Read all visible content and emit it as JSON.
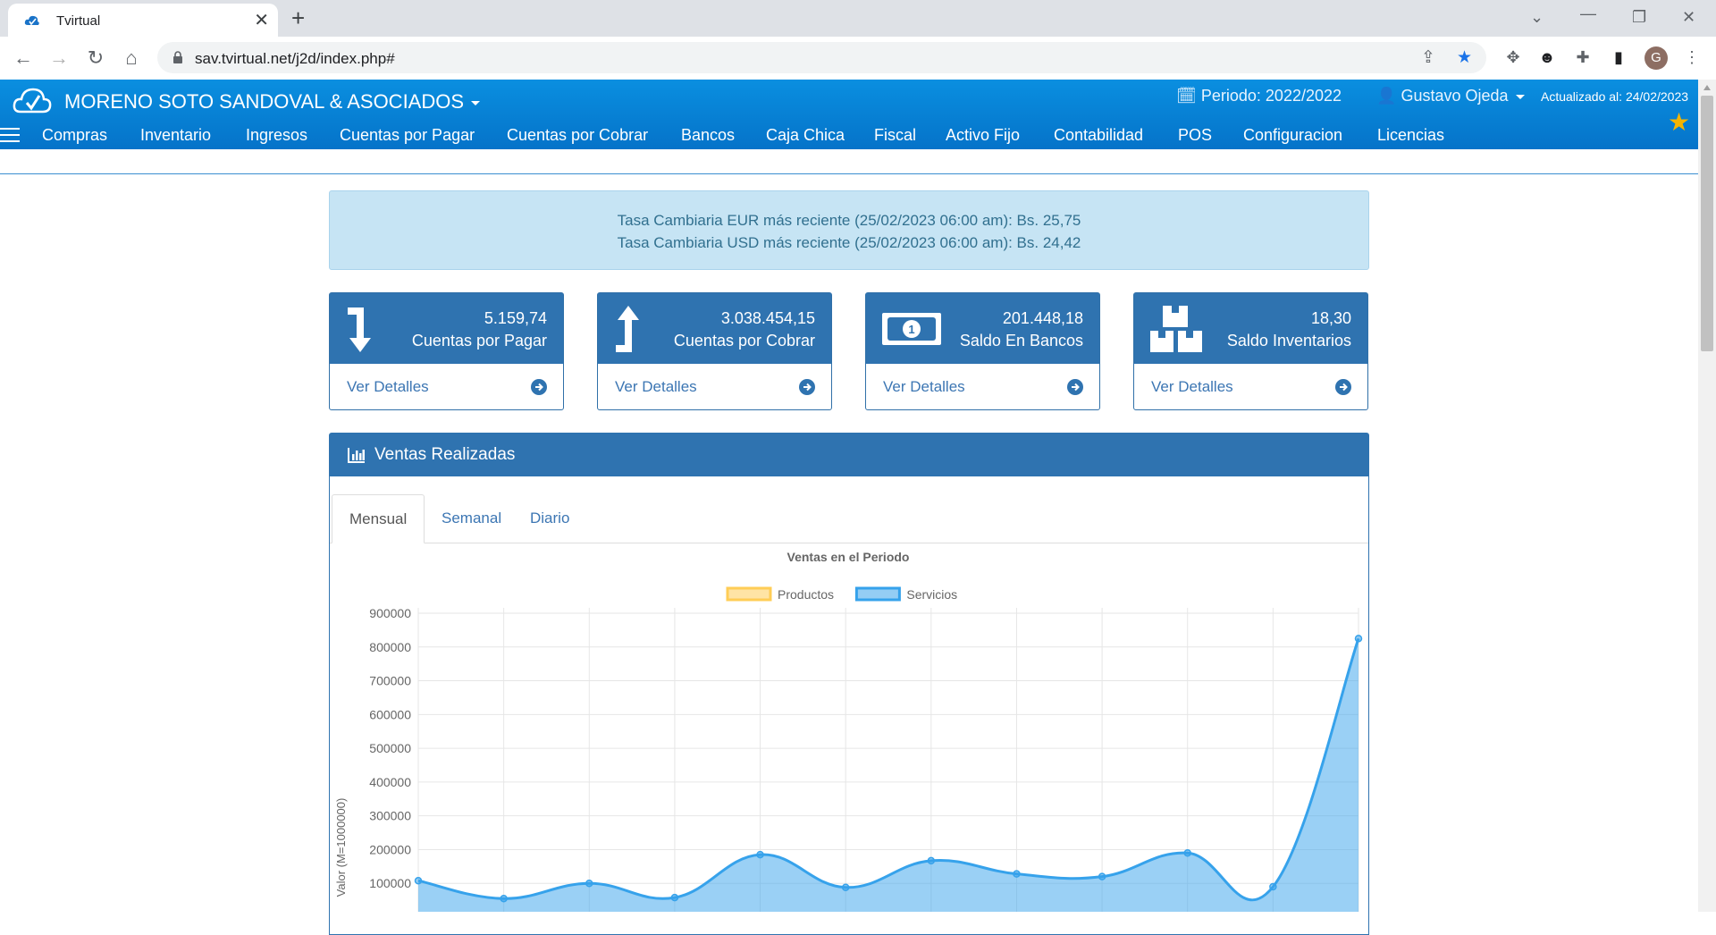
{
  "browser": {
    "tab_title": "Tvirtual",
    "tab_close": "✕",
    "new_tab": "+",
    "url": "sav.tvirtual.net/j2d/index.php#"
  },
  "header": {
    "company": "MORENO SOTO SANDOVAL & ASOCIADOS",
    "periodo": "Periodo: 2022/2022",
    "user": "Gustavo Ojeda",
    "actualizado": "Actualizado al: 24/02/2023"
  },
  "menu": [
    "Compras",
    "Inventario",
    "Ingresos",
    "Cuentas por Pagar",
    "Cuentas por Cobrar",
    "Bancos",
    "Caja Chica",
    "Fiscal",
    "Activo Fijo",
    "Contabilidad",
    "POS",
    "Configuracion",
    "Licencias"
  ],
  "alert": {
    "line1": "Tasa Cambiaria EUR más reciente (25/02/2023 06:00 am): Bs. 25,75",
    "line2": "Tasa Cambiaria USD más reciente (25/02/2023 06:00 am): Bs. 24,42"
  },
  "cards": [
    {
      "value": "5.159,74",
      "label": "Cuentas por Pagar",
      "link": "Ver Detalles",
      "icon": "arrow-down-icon"
    },
    {
      "value": "3.038.454,15",
      "label": "Cuentas por Cobrar",
      "link": "Ver Detalles",
      "icon": "arrow-up-icon"
    },
    {
      "value": "201.448,18",
      "label": "Saldo En Bancos",
      "link": "Ver Detalles",
      "icon": "money-icon"
    },
    {
      "value": "18,30",
      "label": "Saldo Inventarios",
      "link": "Ver Detalles",
      "icon": "boxes-icon"
    }
  ],
  "panel": {
    "title": "Ventas Realizadas",
    "tabs": [
      "Mensual",
      "Semanal",
      "Diario"
    ],
    "active_tab": "Mensual"
  },
  "chart_data": {
    "type": "area",
    "title": "Ventas en el Periodo",
    "ylabel": "Valor (M=1000000)",
    "ylim": [
      0,
      900000
    ],
    "yticks": [
      100000,
      200000,
      300000,
      400000,
      500000,
      600000,
      700000,
      800000,
      900000
    ],
    "legend_position": "top",
    "grid": true,
    "x_points": 12,
    "series": [
      {
        "name": "Productos",
        "color": "#ffcd56",
        "values": [
          0,
          0,
          0,
          0,
          0,
          0,
          0,
          0,
          0,
          0,
          0,
          0
        ]
      },
      {
        "name": "Servicios",
        "color": "#36a2eb",
        "values": [
          108000,
          55000,
          100000,
          58000,
          185000,
          88000,
          167000,
          128000,
          120000,
          190000,
          90000,
          825000
        ]
      }
    ]
  }
}
